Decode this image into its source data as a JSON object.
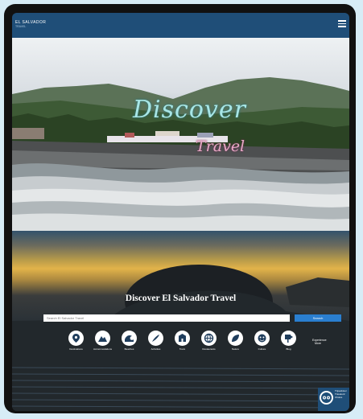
{
  "header": {
    "logo_line1": "EL SALVADOR",
    "logo_line2": "TRAVEL",
    "menu_icon": "hamburger-menu-icon"
  },
  "hero": {
    "script_line1": "Discover",
    "script_line2": "Travel"
  },
  "search_section": {
    "headline": "Discover El Salvador Travel",
    "search_placeholder": "Search El Salvador Travel",
    "search_button": "Search"
  },
  "categories": [
    {
      "label": "Destinations",
      "icon": "map-pin-icon"
    },
    {
      "label": "Accommodations",
      "icon": "mountain-icon"
    },
    {
      "label": "Beaches",
      "icon": "wave-icon"
    },
    {
      "label": "Activities",
      "icon": "surfboard-icon"
    },
    {
      "label": "Tours",
      "icon": "building-icon"
    },
    {
      "label": "Restaurants",
      "icon": "globe-icon"
    },
    {
      "label": "Nature",
      "icon": "leaf-icon"
    },
    {
      "label": "Culture",
      "icon": "mask-icon"
    },
    {
      "label": "Blog",
      "icon": "sign-icon"
    }
  ],
  "more_label": "Experience More",
  "widget": {
    "text": "Tripadvisor Travelers' Choice"
  },
  "colors": {
    "topbar": "#1f4e78",
    "search_button": "#2a7fd0"
  }
}
